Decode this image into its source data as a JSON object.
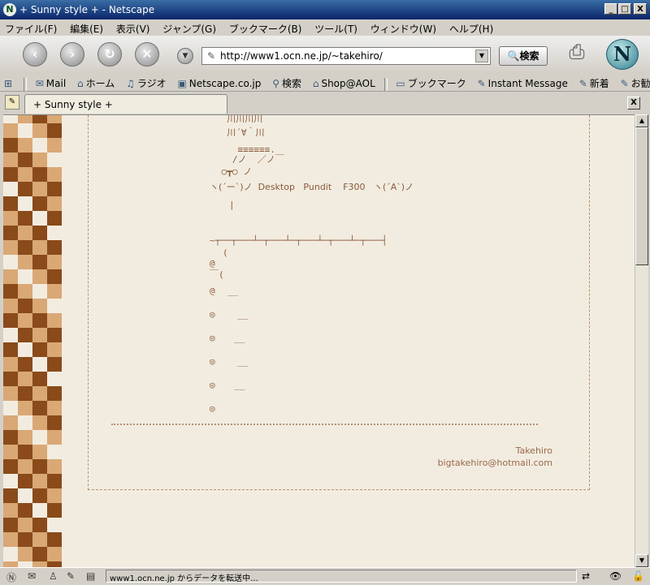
{
  "window": {
    "title": "+ Sunny style + - Netscape",
    "app_icon": "N",
    "controls": {
      "minimize": "_",
      "maximize": "□",
      "close": "X"
    }
  },
  "menu": [
    "ファイル(F)",
    "編集(E)",
    "表示(V)",
    "ジャンプ(G)",
    "ブックマーク(B)",
    "ツール(T)",
    "ウィンドウ(W)",
    "ヘルプ(H)"
  ],
  "toolbar": {
    "back_icon": "back-arrow-icon",
    "forward_icon": "forward-arrow-icon",
    "reload_icon": "reload-icon",
    "stop_icon": "stop-icon",
    "url": "http://www1.ocn.ne.jp/~takehiro/",
    "search_label": "検索",
    "logo": "N"
  },
  "bookmarks": [
    {
      "label": "",
      "icon": "home-sidebar-icon"
    },
    {
      "label": "Mail",
      "icon": "mail-icon"
    },
    {
      "label": "ホーム",
      "icon": "home-icon"
    },
    {
      "label": "ラジオ",
      "icon": "headphones-icon"
    },
    {
      "label": "Netscape.co.jp",
      "icon": "my-icon"
    },
    {
      "label": "検索",
      "icon": "search-icon"
    },
    {
      "label": "Shop@AOL",
      "icon": "shop-icon"
    },
    {
      "label": "ブックマーク",
      "icon": "folder-icon"
    },
    {
      "label": "Instant Message",
      "icon": "bookmark-icon"
    },
    {
      "label": "新着",
      "icon": "bookmark-icon"
    },
    {
      "label": "お勧め",
      "icon": "bookmark-icon"
    }
  ],
  "tab": {
    "label": "+ Sunny style +"
  },
  "page": {
    "aa_lines": [
      "  川川川川",
      "  川´∀｀川",
      "    ≡≡≡≡≡≡.",
      "   /ノ  ／ノ￣",
      " ○┳○ ノ",
      "ヽ(´ー`)ノ  Desktop   Pundit    F300   ヽ(´A`)ノ"
    ],
    "cursor": "|",
    "tree_top": "~┬──┬───┴─┬───┴─┬───┴─┬───┴─┬───┤",
    "tree_rows": [
      {
        "mark": "(",
        "text": ""
      },
      {
        "mark": "@",
        "text": ""
      },
      {
        "mark": "￣(",
        "text": ""
      },
      {
        "mark": "@",
        "text": "__"
      },
      {
        "mark": "◎",
        "text": "__"
      },
      {
        "mark": "◎",
        "text": "__"
      },
      {
        "mark": "◎",
        "text": "__"
      },
      {
        "mark": "◎",
        "text": "__"
      },
      {
        "mark": "◎",
        "text": ""
      }
    ],
    "signature_name": "Takehiro",
    "signature_email": "bigtakehiro@hotmail.com"
  },
  "status": {
    "text": "www1.ocn.ne.jp からデータを転送中..."
  },
  "colors": {
    "page_bg": "#f2ece0",
    "text_brown": "#8a5a3a",
    "checker_dark": "#8a4a1a",
    "checker_light": "#d9a875"
  }
}
